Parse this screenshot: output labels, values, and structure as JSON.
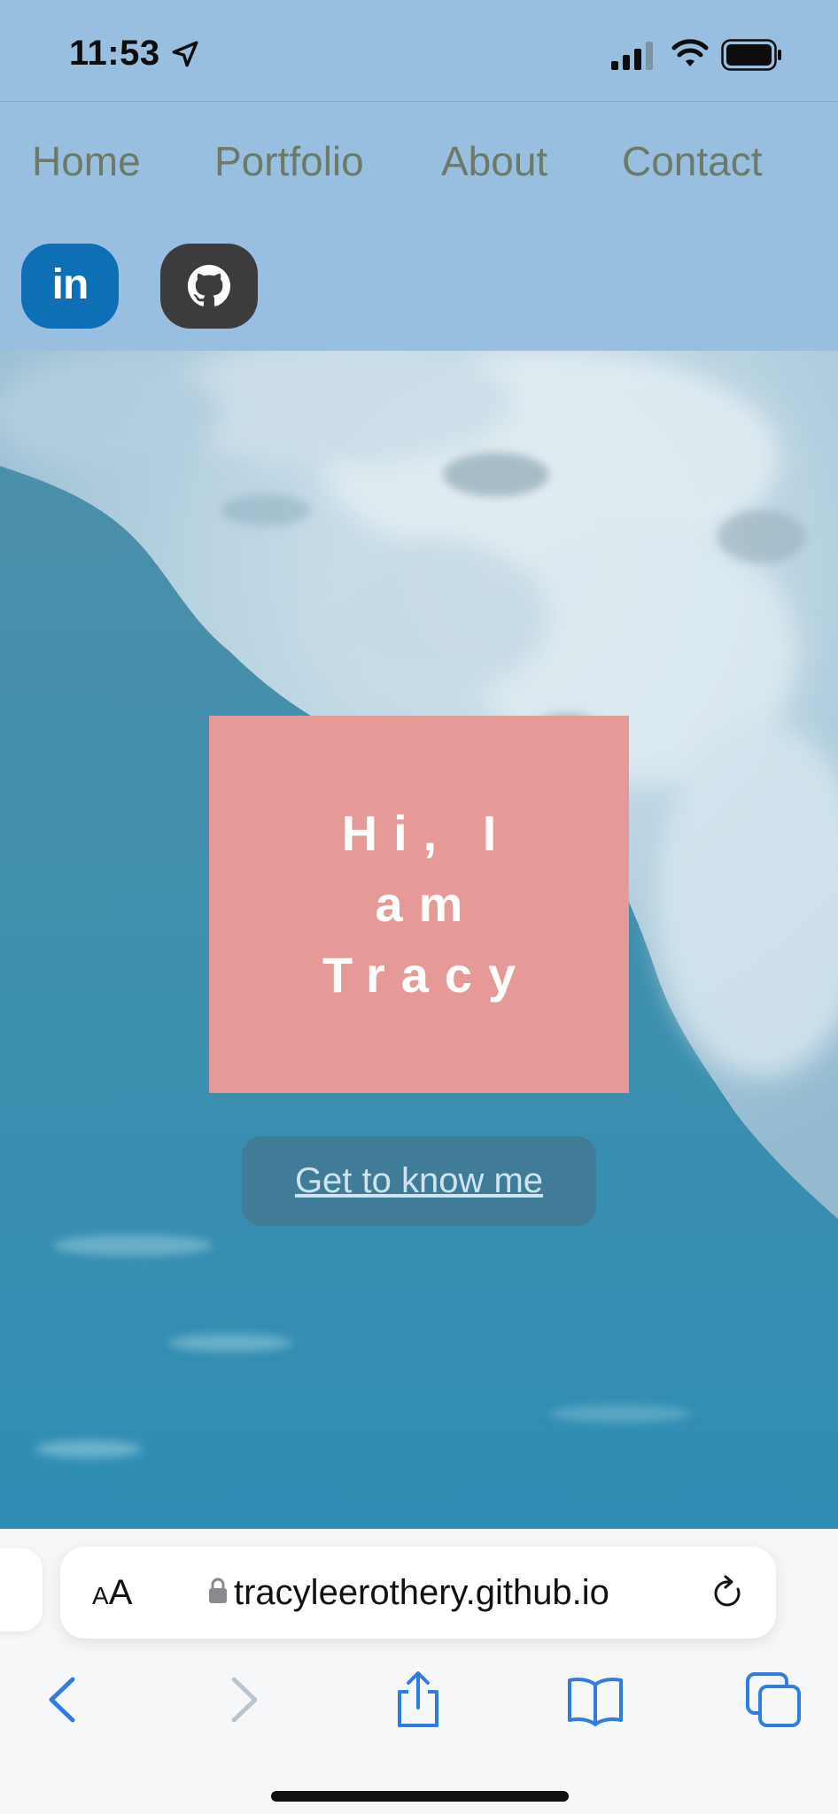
{
  "status_bar": {
    "time": "11:53",
    "icons": [
      "location-arrow-icon",
      "cellular-signal-icon",
      "wifi-icon",
      "battery-icon"
    ]
  },
  "nav": {
    "items": [
      {
        "label": "Home"
      },
      {
        "label": "Portfolio"
      },
      {
        "label": "About"
      },
      {
        "label": "Contact"
      }
    ]
  },
  "social": {
    "linkedin": {
      "label": "in",
      "icon": "linkedin-icon",
      "color": "#0e70b4"
    },
    "github": {
      "icon": "github-icon",
      "color": "#3c3c3c"
    }
  },
  "hero": {
    "intro_line1": "Hi, I",
    "intro_line2": "am",
    "intro_line3": "Tracy",
    "cta_label": "Get to know me",
    "box_color": "#e69a98",
    "header_color": "#98bee0"
  },
  "browser": {
    "text_size_small": "A",
    "text_size_big": "A",
    "url": "tracyleerothery.github.io",
    "toolbar_icons": [
      "back-icon",
      "forward-icon",
      "share-icon",
      "bookmarks-icon",
      "tabs-icon"
    ]
  }
}
